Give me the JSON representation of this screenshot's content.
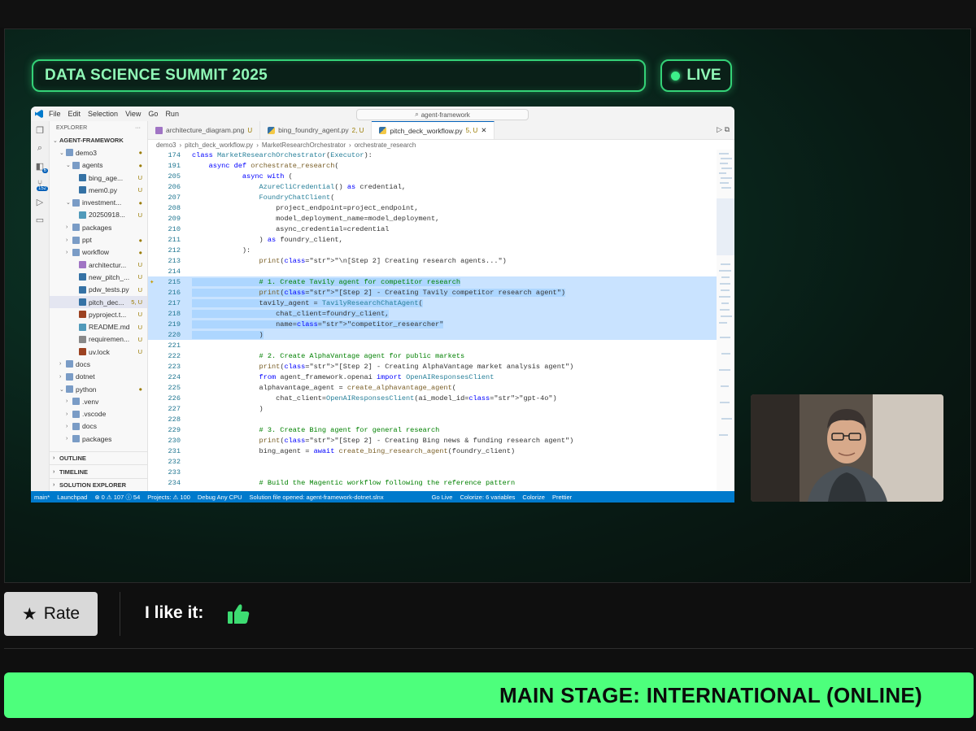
{
  "banner": {
    "title": "DATA SCIENCE SUMMIT 2025",
    "live": "LIVE"
  },
  "vscode": {
    "menu": [
      "File",
      "Edit",
      "Selection",
      "View",
      "Go",
      "Run"
    ],
    "search": "agent-framework",
    "explorer_title": "EXPLORER",
    "tree": [
      {
        "label": "AGENT-FRAMEWORK",
        "type": "root"
      },
      {
        "label": "demo3",
        "type": "folder",
        "status": "●"
      },
      {
        "label": "agents",
        "type": "folder",
        "status": "●"
      },
      {
        "label": "bing_age...",
        "type": "py",
        "status": "U"
      },
      {
        "label": "mem0.py",
        "type": "py",
        "status": "U"
      },
      {
        "label": "investment...",
        "type": "folder",
        "status": "●"
      },
      {
        "label": "20250918...",
        "type": "md",
        "status": "U"
      },
      {
        "label": "packages",
        "type": "folder",
        "status": ""
      },
      {
        "label": "ppt",
        "type": "folder",
        "status": "●"
      },
      {
        "label": "workflow",
        "type": "folder",
        "status": "●"
      },
      {
        "label": "architectur...",
        "type": "img",
        "status": "U"
      },
      {
        "label": "new_pitch_...",
        "type": "py",
        "status": "U"
      },
      {
        "label": "pdw_tests.py",
        "type": "py",
        "status": "U"
      },
      {
        "label": "pitch_dec...",
        "type": "py",
        "status": "5, U"
      },
      {
        "label": "pyproject.t...",
        "type": "toml",
        "status": "U"
      },
      {
        "label": "README.md",
        "type": "md",
        "status": "U"
      },
      {
        "label": "requiremen...",
        "type": "txt",
        "status": "U"
      },
      {
        "label": "uv.lock",
        "type": "lock",
        "status": "U"
      },
      {
        "label": "docs",
        "type": "folder",
        "status": ""
      },
      {
        "label": "dotnet",
        "type": "folder",
        "status": ""
      },
      {
        "label": "python",
        "type": "folder",
        "status": "●"
      },
      {
        "label": ".venv",
        "type": "folder",
        "status": ""
      },
      {
        "label": ".vscode",
        "type": "folder",
        "status": ""
      },
      {
        "label": "docs",
        "type": "folder",
        "status": ""
      },
      {
        "label": "packages",
        "type": "folder",
        "status": ""
      }
    ],
    "panels": [
      "OUTLINE",
      "TIMELINE",
      "SOLUTION EXPLORER"
    ],
    "tabs": [
      {
        "label": "architecture_diagram.png",
        "status": "U"
      },
      {
        "label": "bing_foundry_agent.py",
        "status": "2, U"
      },
      {
        "label": "pitch_deck_workflow.py",
        "status": "5, U"
      }
    ],
    "breadcrumbs": [
      "demo3",
      "pitch_deck_workflow.py",
      "MarketResearchOrchestrator",
      "orchestrate_research"
    ],
    "code": [
      {
        "n": "174",
        "t": "class MarketResearchOrchestrator(Executor):"
      },
      {
        "n": "191",
        "t": "    async def orchestrate_research("
      },
      {
        "n": "205",
        "t": "            async with ("
      },
      {
        "n": "206",
        "t": "                AzureCliCredential() as credential,"
      },
      {
        "n": "207",
        "t": "                FoundryChatClient("
      },
      {
        "n": "208",
        "t": "                    project_endpoint=project_endpoint,"
      },
      {
        "n": "209",
        "t": "                    model_deployment_name=model_deployment,"
      },
      {
        "n": "210",
        "t": "                    async_credential=credential"
      },
      {
        "n": "211",
        "t": "                ) as foundry_client,"
      },
      {
        "n": "212",
        "t": "            ):"
      },
      {
        "n": "213",
        "t": "                print(\"\\n[Step 2] Creating research agents...\")"
      },
      {
        "n": "214",
        "t": ""
      },
      {
        "n": "215",
        "t": "                # 1. Create Tavily agent for competitor research"
      },
      {
        "n": "216",
        "t": "                print(\"[Step 2] - Creating Tavily competitor research agent\")"
      },
      {
        "n": "217",
        "t": "                tavily_agent = TavilyResearchChatAgent("
      },
      {
        "n": "218",
        "t": "                    chat_client=foundry_client,"
      },
      {
        "n": "219",
        "t": "                    name=\"competitor_researcher\""
      },
      {
        "n": "220",
        "t": "                )"
      },
      {
        "n": "221",
        "t": ""
      },
      {
        "n": "222",
        "t": "                # 2. Create AlphaVantage agent for public markets"
      },
      {
        "n": "223",
        "t": "                print(\"[Step 2] - Creating AlphaVantage market analysis agent\")"
      },
      {
        "n": "224",
        "t": "                from agent_framework.openai import OpenAIResponsesClient"
      },
      {
        "n": "225",
        "t": "                alphavantage_agent = create_alphavantage_agent("
      },
      {
        "n": "226",
        "t": "                    chat_client=OpenAIResponsesClient(ai_model_id=\"gpt-4o\")"
      },
      {
        "n": "227",
        "t": "                )"
      },
      {
        "n": "228",
        "t": ""
      },
      {
        "n": "229",
        "t": "                # 3. Create Bing agent for general research"
      },
      {
        "n": "230",
        "t": "                print(\"[Step 2] - Creating Bing news & funding research agent\")"
      },
      {
        "n": "231",
        "t": "                bing_agent = await create_bing_research_agent(foundry_client)"
      },
      {
        "n": "232",
        "t": ""
      },
      {
        "n": "233",
        "t": ""
      },
      {
        "n": "234",
        "t": "                # Build the Magentic workflow following the reference pattern"
      }
    ],
    "status": [
      "main*",
      "Launchpad",
      "⊗ 0 ⚠ 107 ⓘ 54",
      "Projects: ⚠ 100",
      "Debug Any CPU",
      "Solution file opened: agent-framework-dotnet.slnx",
      "Go Live",
      "Colorize: 6 variables",
      "Colorize",
      "Prettier"
    ]
  },
  "controls": {
    "rate": "Rate",
    "like": "I like it:"
  },
  "footer": {
    "stage": "MAIN STAGE: INTERNATIONAL (ONLINE)"
  },
  "colors": {
    "accent": "#4dff7c",
    "live_border": "#34d277"
  }
}
